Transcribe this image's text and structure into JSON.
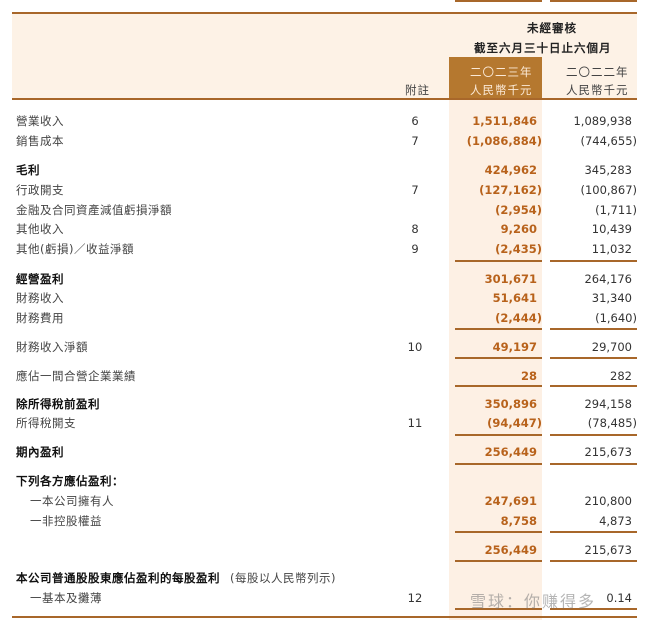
{
  "header": {
    "audit_status": "未經審核",
    "period": "截至六月三十日止六個月",
    "note_col": "附註",
    "col_2023_year": "二〇二三年",
    "col_2023_unit": "人民幣千元",
    "col_2022_year": "二〇二二年",
    "col_2022_unit": "人民幣千元"
  },
  "colors": {
    "accent": "#b5782f",
    "value_2023": "#b8621b",
    "rule": "#a8672a",
    "band": "#fdf2e6"
  },
  "rows": [
    {
      "label": "營業收入",
      "note": "6",
      "v2023": "1,511,846",
      "v2022": "1,089,938"
    },
    {
      "label": "銷售成本",
      "note": "7",
      "v2023": "(1,086,884)",
      "v2022": "(744,655)",
      "rule_below": true
    },
    {
      "label": "毛利",
      "bold": true,
      "v2023": "424,962",
      "v2022": "345,283"
    },
    {
      "label": "行政開支",
      "note": "7",
      "v2023": "(127,162)",
      "v2022": "(100,867)"
    },
    {
      "label": "金融及合同資產減值虧損淨額",
      "v2023": "(2,954)",
      "v2022": "(1,711)"
    },
    {
      "label": "其他收入",
      "note": "8",
      "v2023": "9,260",
      "v2022": "10,439"
    },
    {
      "label": "其他(虧損)／收益淨額",
      "note": "9",
      "v2023": "(2,435)",
      "v2022": "11,032",
      "rule_below": true
    },
    {
      "label": "經營盈利",
      "bold": true,
      "v2023": "301,671",
      "v2022": "264,176"
    },
    {
      "label": "財務收入",
      "v2023": "51,641",
      "v2022": "31,340"
    },
    {
      "label": "財務費用",
      "v2023": "(2,444)",
      "v2022": "(1,640)",
      "rule_below": true
    },
    {
      "label": "財務收入淨額",
      "note": "10",
      "v2023": "49,197",
      "v2022": "29,700",
      "rule_below": true
    },
    {
      "label": "應佔一間合營企業業績",
      "v2023": "28",
      "v2022": "282",
      "rule_below": true
    },
    {
      "label": "除所得稅前盈利",
      "bold": true,
      "v2023": "350,896",
      "v2022": "294,158"
    },
    {
      "label": "所得稅開支",
      "note": "11",
      "v2023": "(94,447)",
      "v2022": "(78,485)",
      "rule_below": true
    },
    {
      "label": "期內盈利",
      "bold": true,
      "v2023": "256,449",
      "v2022": "215,673",
      "rule_below": true
    },
    {
      "label": "下列各方應佔盈利：",
      "bold": true
    },
    {
      "label": "一本公司擁有人",
      "indent": true,
      "v2023": "247,691",
      "v2022": "210,800"
    },
    {
      "label": "一非控股權益",
      "indent": true,
      "v2023": "8,758",
      "v2022": "4,873",
      "rule_below": true
    },
    {
      "label": "",
      "v2023": "256,449",
      "v2022": "215,673",
      "rule_below": true
    },
    {
      "label": "本公司普通股股東應佔盈利的每股盈利",
      "label_suffix": "(每股以人民幣列示)",
      "bold": true
    },
    {
      "label": "一基本及攤薄",
      "indent": true,
      "note": "12",
      "v2023": "",
      "v2022": "0.14",
      "rule_below": true
    }
  ],
  "watermark": "雪球：你赚得多"
}
